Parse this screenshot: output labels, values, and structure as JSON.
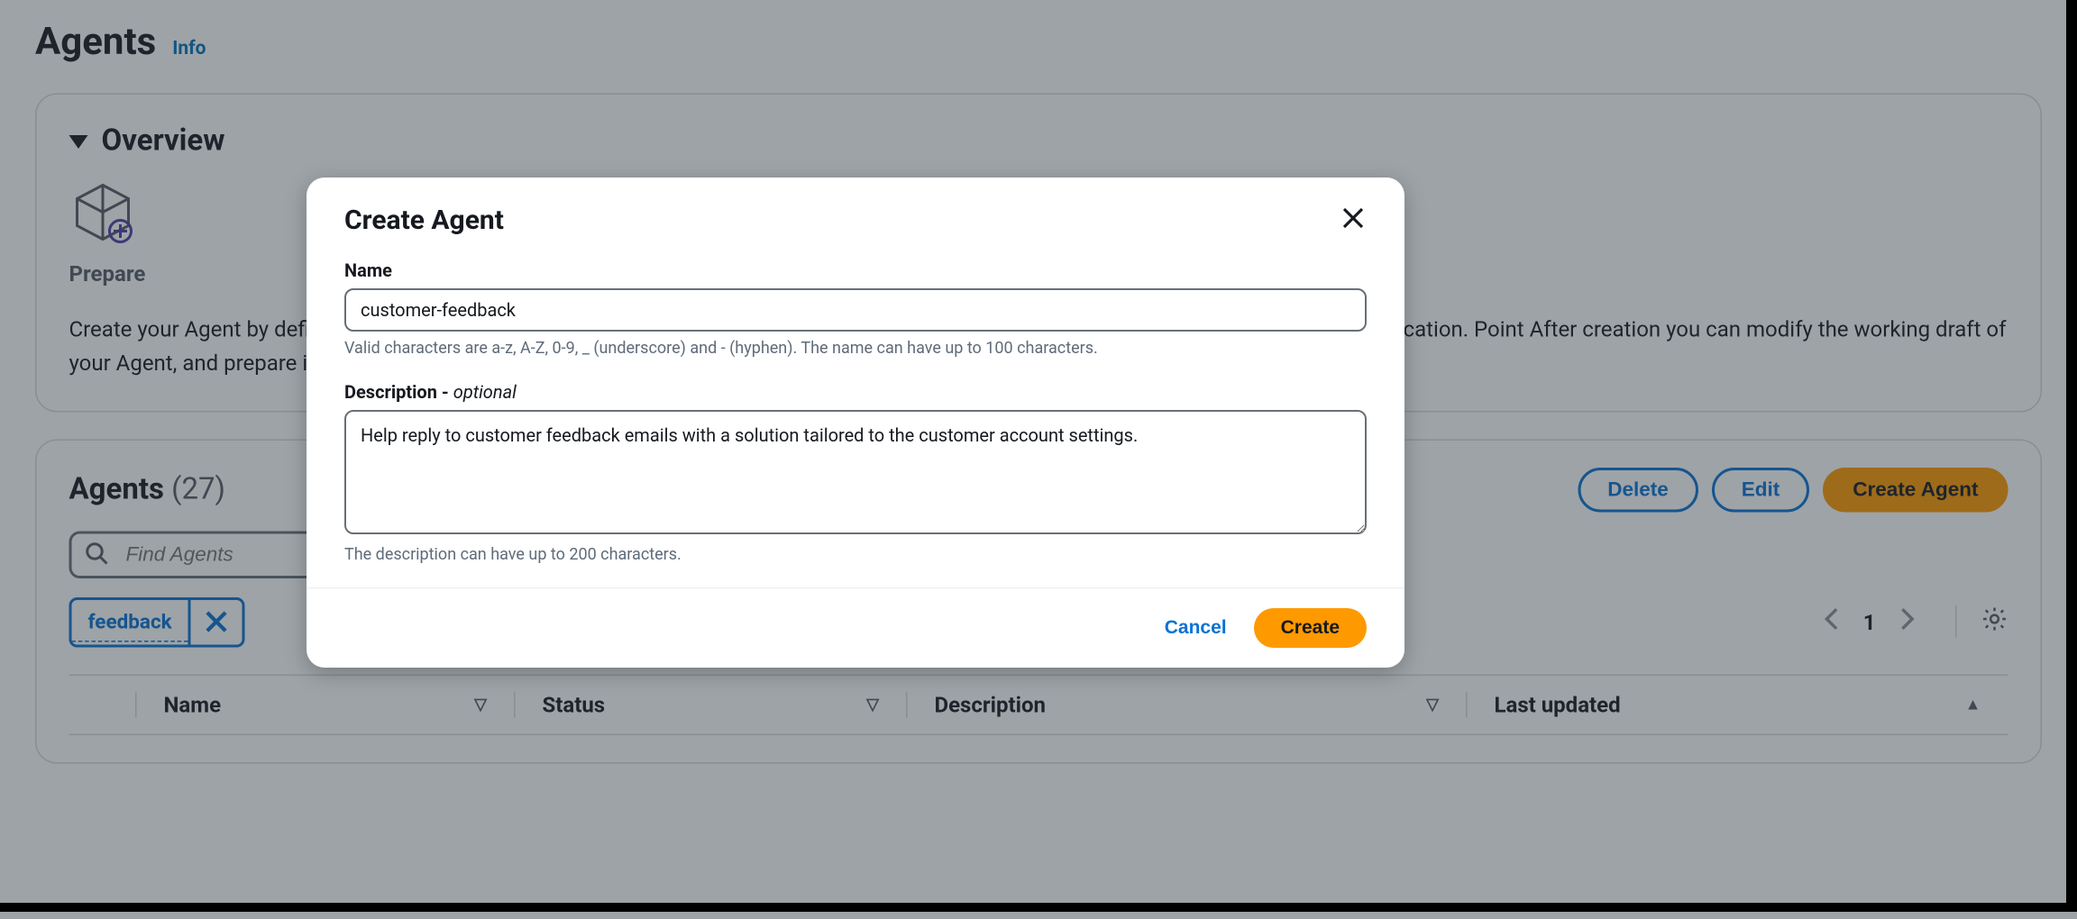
{
  "page": {
    "title": "Agents",
    "info_label": "Info"
  },
  "overview": {
    "title": "Overview",
    "prepare_label": "Prepare",
    "description": "Create your Agent by defining an orchestration strategy and adding tools the Agent will have access to deploy an Agent version in your application. Point After creation you can modify the working draft of your Agent, and prepare it for testing. Create a version of your Agent to test it before deploying it to your versions."
  },
  "agentsList": {
    "title_prefix": "Agents",
    "count": "(27)",
    "actions": {
      "delete": "Delete",
      "edit": "Edit",
      "create": "Create Agent"
    },
    "search_placeholder": "Find Agents",
    "filter_chip": "feedback",
    "pagination": {
      "page": "1"
    },
    "columns": {
      "name": "Name",
      "status": "Status",
      "description": "Description",
      "last_updated": "Last updated"
    }
  },
  "modal": {
    "title": "Create Agent",
    "name_label": "Name",
    "name_value": "customer-feedback",
    "name_hint": "Valid characters are a-z, A-Z, 0-9, _ (underscore) and - (hyphen). The name can have up to 100 characters.",
    "desc_label_prefix": "Description -",
    "desc_label_optional": "optional",
    "desc_value": "Help reply to customer feedback emails with a solution tailored to the customer account settings.",
    "desc_hint": "The description can have up to 200 characters.",
    "cancel": "Cancel",
    "create": "Create"
  }
}
